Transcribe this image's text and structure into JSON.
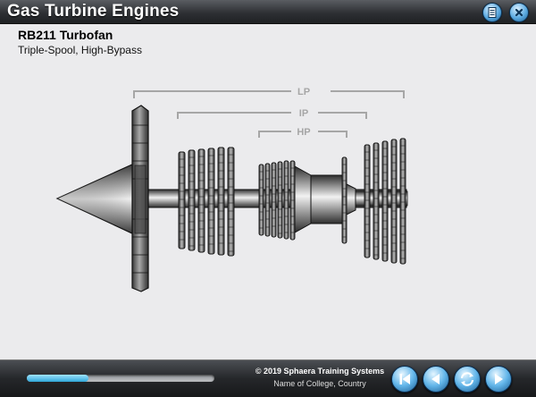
{
  "app": {
    "title": "Gas Turbine Engines"
  },
  "header_buttons": [
    {
      "name": "menu-button",
      "icon": "document-list-icon"
    },
    {
      "name": "close-button",
      "icon": "close-icon"
    }
  ],
  "slide": {
    "heading": "RB211 Turbofan",
    "subheading": "Triple-Spool, High-Bypass",
    "spool_labels": {
      "lp": "LP",
      "ip": "IP",
      "hp": "HP"
    }
  },
  "footer": {
    "progress": 0.33,
    "copyright": "© 2019 Sphaera Training Systems",
    "college": "Name of College, Country",
    "buttons": [
      {
        "name": "restart-button",
        "icon": "skip-back-icon"
      },
      {
        "name": "back-button",
        "icon": "play-left-icon"
      },
      {
        "name": "replay-button",
        "icon": "replay-icon"
      },
      {
        "name": "next-button",
        "icon": "play-right-icon"
      }
    ]
  },
  "colors": {
    "accent": "#3fa9dc",
    "header_bg": "#2e3034",
    "bracket": "#a6a6a6"
  }
}
